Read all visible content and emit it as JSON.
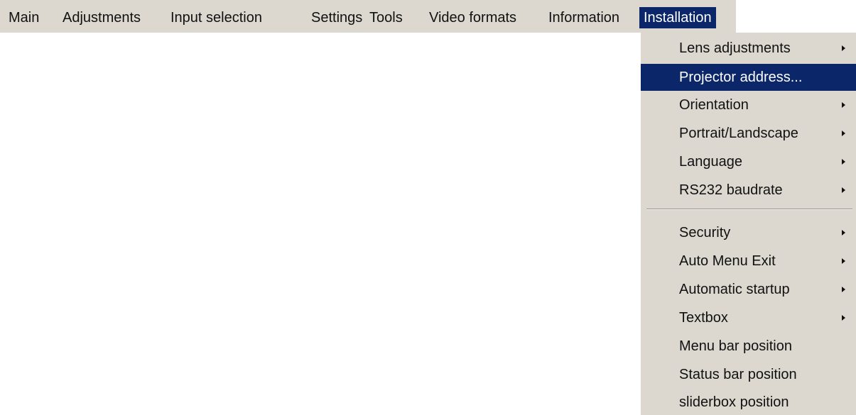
{
  "colors": {
    "menu_background": "#dcd8d0",
    "highlight": "#0b2769",
    "highlight_text": "#ffffff",
    "text": "#111111"
  },
  "menubar": {
    "items": [
      {
        "label": "Main"
      },
      {
        "label": "Adjustments"
      },
      {
        "label": "Input selection"
      },
      {
        "label": "Settings"
      },
      {
        "label": "Tools"
      },
      {
        "label": "Video formats"
      },
      {
        "label": "Information"
      },
      {
        "label": "Installation",
        "active": true
      }
    ]
  },
  "installation_menu": {
    "items": [
      {
        "label": "Lens adjustments",
        "submenu": true,
        "submenu_icon": "triangle-right-icon"
      },
      {
        "label": "Projector address...",
        "selected": true
      },
      {
        "label": "Orientation",
        "submenu": true,
        "submenu_icon": "triangle-right-icon"
      },
      {
        "label": "Portrait/Landscape",
        "submenu": true,
        "submenu_icon": "triangle-right-icon"
      },
      {
        "label": "Language",
        "submenu": true,
        "submenu_icon": "triangle-right-icon"
      },
      {
        "label": "RS232 baudrate",
        "submenu": true,
        "submenu_icon": "triangle-right-icon"
      },
      {
        "label": "Security",
        "submenu": true,
        "submenu_icon": "triangle-right-icon"
      },
      {
        "label": "Auto Menu Exit",
        "submenu": true,
        "submenu_icon": "triangle-right-icon"
      },
      {
        "label": "Automatic startup",
        "submenu": true,
        "submenu_icon": "triangle-right-icon"
      },
      {
        "label": "Textbox",
        "submenu": true,
        "submenu_icon": "triangle-right-icon"
      },
      {
        "label": "Menu bar position"
      },
      {
        "label": "Status bar position"
      },
      {
        "label": "sliderbox position"
      }
    ]
  }
}
